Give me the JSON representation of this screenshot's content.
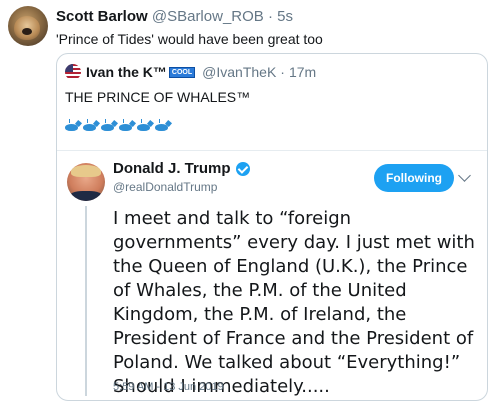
{
  "tweet": {
    "display_name": "Scott Barlow",
    "handle": "@SBarlow_ROB",
    "separator": "·",
    "time": "5s",
    "text": "'Prince of Tides' would have been great too"
  },
  "quoted_tweet": {
    "display_name": "Ivan the K™",
    "badge": "COOL",
    "handle": "@IvanTheK",
    "separator": "·",
    "time": "17m",
    "text": "THE PRINCE OF WHALES™",
    "whale_count": 6
  },
  "embedded_tweet": {
    "display_name": "Donald J. Trump",
    "handle": "@realDonaldTrump",
    "follow_label": "Following",
    "text": "I meet and talk to “foreign governments” every day. I just met with the Queen of England (U.K.), the Prince of Whales, the P.M. of the United Kingdom, the P.M. of Ireland, the President of France and the President of Poland. We talked about “Everything!” Should I immediately.....",
    "timestamp": "5:59 AM - 13 Jun 2019"
  },
  "colors": {
    "accent": "#1da1f2",
    "muted_text": "#657786",
    "border": "#ccd6dd"
  },
  "icons": {
    "verified": "verified-badge-icon",
    "menu": "chevron-down-icon",
    "whale": "whale-emoji-icon"
  }
}
